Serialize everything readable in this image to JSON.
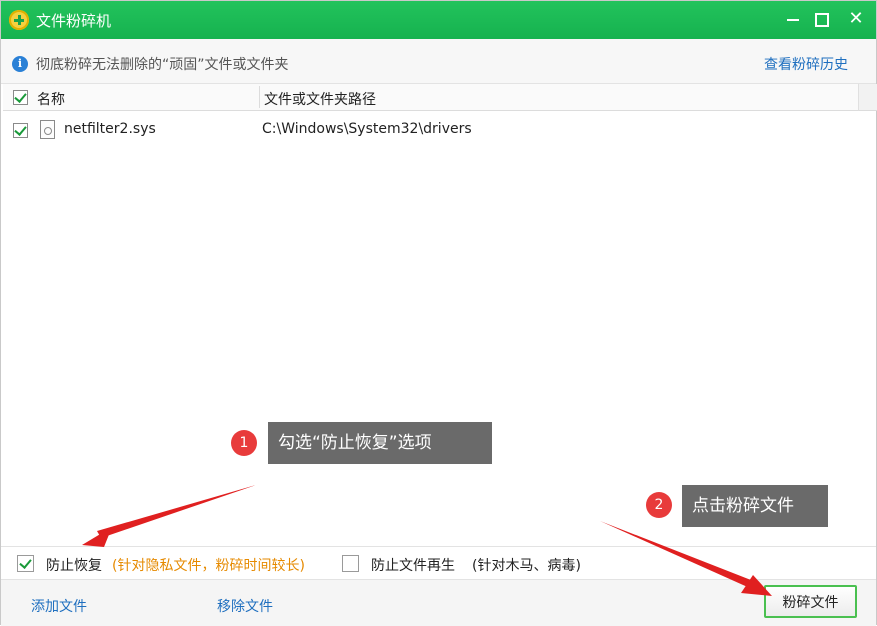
{
  "window": {
    "title": "文件粉碎机",
    "minimize_symbol": "",
    "maximize_symbol": "",
    "close_symbol": "✕"
  },
  "info": {
    "icon_text": "i",
    "text": "彻底粉碎无法删除的“顽固”文件或文件夹",
    "history_link": "查看粉碎历史"
  },
  "table": {
    "columns": [
      "名称",
      "文件或文件夹路径"
    ],
    "rows": [
      {
        "name": "netfilter2.sys",
        "path": "C:\\Windows\\System32\\drivers",
        "checked": true
      }
    ]
  },
  "options": {
    "prevent_recovery_label": "防止恢复",
    "prevent_recovery_note": "(针对隐私文件，粉碎时间较长)",
    "prevent_regen_label": "防止文件再生",
    "prevent_regen_note": "(针对木马、病毒)"
  },
  "footer": {
    "add_file": "添加文件",
    "remove_file": "移除文件",
    "shred_button": "粉碎文件"
  },
  "annotations": {
    "step1_number": "1",
    "step1_text": "勾选“防止恢复”选项",
    "step2_number": "2",
    "step2_text": "点击粉碎文件"
  },
  "colors": {
    "titlebar": "#1db954",
    "link": "#1f6fbf",
    "note_orange": "#e68a00",
    "callout_red": "#e83b3b",
    "callout_box": "#6a6a6a",
    "arrow_red": "#e02020"
  }
}
